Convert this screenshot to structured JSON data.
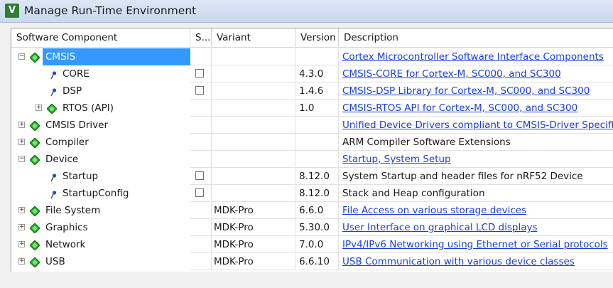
{
  "window": {
    "title": "Manage Run-Time Environment"
  },
  "columns": {
    "component": "Software Component",
    "sel": "S...",
    "variant": "Variant",
    "version": "Version",
    "description": "Description"
  },
  "rows": [
    {
      "name": "CMSIS",
      "level": 0,
      "expander": "−",
      "icon": "diamond",
      "selected": true,
      "checkbox": false,
      "variant": "",
      "version": "",
      "description": "Cortex Microcontroller Software Interface Components",
      "link": true
    },
    {
      "name": "CORE",
      "level": 1,
      "expander": "",
      "icon": "pin",
      "selected": false,
      "checkbox": true,
      "variant": "",
      "version": "4.3.0",
      "description": "CMSIS-CORE for Cortex-M, SC000, and SC300",
      "link": true
    },
    {
      "name": "DSP",
      "level": 1,
      "expander": "",
      "icon": "pin",
      "selected": false,
      "checkbox": true,
      "variant": "",
      "version": "1.4.6",
      "description": "CMSIS-DSP Library for Cortex-M, SC000, and SC300",
      "link": true
    },
    {
      "name": "RTOS (API)",
      "level": 1,
      "expander": "+",
      "icon": "diamond",
      "selected": false,
      "checkbox": false,
      "variant": "",
      "version": "1.0",
      "description": "CMSIS-RTOS API for Cortex-M, SC000, and SC300",
      "link": true
    },
    {
      "name": "CMSIS Driver",
      "level": 0,
      "expander": "+",
      "icon": "diamond",
      "selected": false,
      "checkbox": false,
      "variant": "",
      "version": "",
      "description": "Unified Device Drivers compliant to CMSIS-Driver Specific",
      "link": true
    },
    {
      "name": "Compiler",
      "level": 0,
      "expander": "+",
      "icon": "diamond",
      "selected": false,
      "checkbox": false,
      "variant": "",
      "version": "",
      "description": "ARM Compiler Software Extensions",
      "link": false
    },
    {
      "name": "Device",
      "level": 0,
      "expander": "−",
      "icon": "diamond",
      "selected": false,
      "checkbox": false,
      "variant": "",
      "version": "",
      "description": "Startup, System Setup",
      "link": true
    },
    {
      "name": "Startup",
      "level": 1,
      "expander": "",
      "icon": "pin",
      "selected": false,
      "checkbox": true,
      "variant": "",
      "version": "8.12.0",
      "description": "System Startup and header files for nRF52 Device",
      "link": false
    },
    {
      "name": "StartupConfig",
      "level": 1,
      "expander": "",
      "icon": "pin",
      "selected": false,
      "checkbox": true,
      "variant": "",
      "version": "8.12.0",
      "description": "Stack and Heap configuration",
      "link": false
    },
    {
      "name": "File System",
      "level": 0,
      "expander": "+",
      "icon": "diamond",
      "selected": false,
      "checkbox": false,
      "variant": "MDK-Pro",
      "version": "6.6.0",
      "description": "File Access on various storage devices",
      "link": true
    },
    {
      "name": "Graphics",
      "level": 0,
      "expander": "+",
      "icon": "diamond",
      "selected": false,
      "checkbox": false,
      "variant": "MDK-Pro",
      "version": "5.30.0",
      "description": "User Interface on graphical LCD displays",
      "link": true
    },
    {
      "name": "Network",
      "level": 0,
      "expander": "+",
      "icon": "diamond",
      "selected": false,
      "checkbox": false,
      "variant": "MDK-Pro",
      "version": "7.0.0",
      "description": "IPv4/IPv6 Networking using Ethernet or Serial protocols",
      "link": true
    },
    {
      "name": "USB",
      "level": 0,
      "expander": "+",
      "icon": "diamond",
      "selected": false,
      "checkbox": false,
      "variant": "MDK-Pro",
      "version": "6.6.10",
      "description": "USB Communication with various device classes",
      "link": true
    }
  ],
  "colors": {
    "selection": "#3399ff",
    "link": "#1a3fd6",
    "diamond": "#22aa22"
  }
}
